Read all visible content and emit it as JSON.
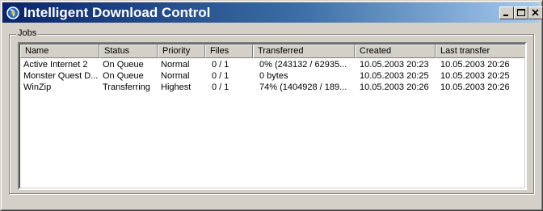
{
  "window": {
    "title": "Intelligent Download Control"
  },
  "group": {
    "label": "Jobs"
  },
  "columns": [
    "Name",
    "Status",
    "Priority",
    "Files",
    "Transferred",
    "Created",
    "Last transfer"
  ],
  "rows": [
    [
      "Active Internet 2",
      "On Queue",
      "Normal",
      "0 / 1",
      "0%  (243132 / 62935...",
      "10.05.2003 20:23",
      "10.05.2003 20:26"
    ],
    [
      "Monster Quest D...",
      "On Queue",
      "Normal",
      "0 / 1",
      "0 bytes",
      "10.05.2003 20:25",
      "10.05.2003 20:25"
    ],
    [
      "WinZip",
      "Transferring",
      "Highest",
      "0 / 1",
      "74%  (1404928 / 189...",
      "10.05.2003 20:26",
      "10.05.2003 20:26"
    ]
  ],
  "colors": {
    "title_start": "#0a246a",
    "title_end": "#a6caf0",
    "face": "#d4d0c8"
  },
  "icons": [
    "app-icon",
    "minimize-icon",
    "maximize-icon",
    "close-icon"
  ]
}
